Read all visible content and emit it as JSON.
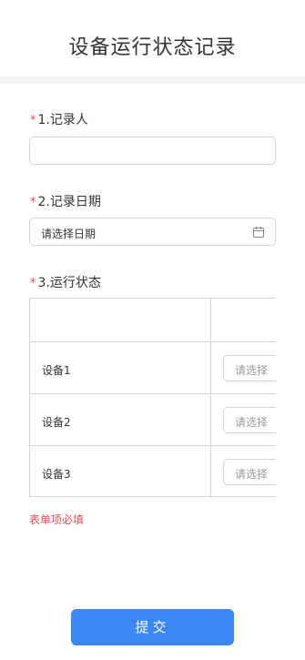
{
  "form": {
    "title": "设备运行状态记录",
    "required_mark": "*",
    "questions": [
      {
        "label": "1.记录人",
        "value": ""
      },
      {
        "label": "2.记录日期",
        "placeholder": "请选择日期"
      },
      {
        "label": "3.运行状态"
      }
    ],
    "status_table": {
      "rows": [
        {
          "device": "设备1",
          "select_placeholder": "请选择"
        },
        {
          "device": "设备2",
          "select_placeholder": "请选择"
        },
        {
          "device": "设备3",
          "select_placeholder": "请选择"
        }
      ]
    },
    "error_message": "表单项必填",
    "submit_label": "提交"
  },
  "icons": {
    "date_picker": "calendar-icon"
  },
  "colors": {
    "required": "#e34d59",
    "primary": "#3a87f5",
    "border": "#d5d5d5"
  }
}
